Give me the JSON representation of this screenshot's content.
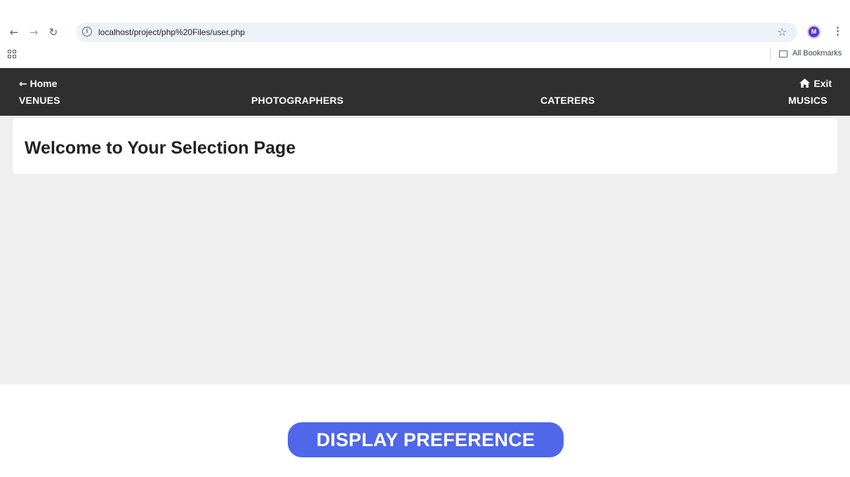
{
  "browser": {
    "url": "localhost/project/php%20Files/user.php",
    "profile_initial": "M",
    "bookmarks_label": "All Bookmarks",
    "icons": [
      "back-arrow-icon",
      "forward-arrow-icon",
      "reload-icon",
      "site-info-icon",
      "bookmark-star-icon",
      "kebab-menu-icon",
      "apps-grid-icon",
      "folder-icon"
    ]
  },
  "site_nav": {
    "home_label": "Home",
    "exit_label": "Exit",
    "items": [
      "VENUES",
      "PHOTOGRAPHERS",
      "CATERERS",
      "MUSICS"
    ],
    "background_color": "#2f2f2f"
  },
  "main": {
    "welcome_title": "Welcome to Your Selection Page",
    "background_color": "#efefef"
  },
  "caption": {
    "label": "DISPLAY PREFERENCE",
    "color": "#4f67e8"
  }
}
